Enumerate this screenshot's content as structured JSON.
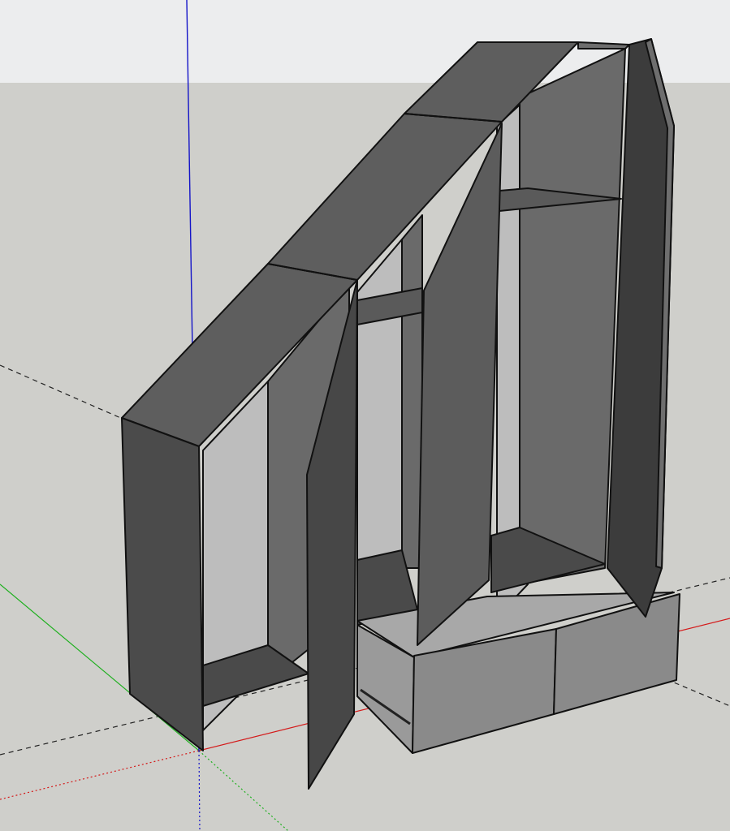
{
  "app": {
    "viewport": "sketchup-3d-modeling-viewport"
  },
  "colors": {
    "sky": "#ecedee",
    "ground": "#cfcfcb",
    "axis_red": "#d41a1a",
    "axis_green": "#1fb01f",
    "axis_blue": "#1414c8",
    "panel_dark": "#4b4b4b",
    "panel_mid": "#5f5f5f",
    "panel_side": "#3a3a3a",
    "interior_light": "#bdbdbd",
    "drawer_front": "#8a8a8a",
    "edge": "#111111"
  },
  "model": {
    "object": "under-stair-wardrobe",
    "doors_open": 3,
    "drawers_open": 2
  }
}
